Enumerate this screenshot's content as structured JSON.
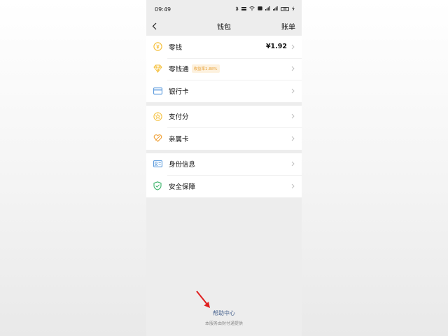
{
  "status_bar": {
    "time": "09:49",
    "battery": "88"
  },
  "nav": {
    "title": "钱包",
    "right_label": "账单"
  },
  "groups": [
    {
      "items": [
        {
          "label": "零钱",
          "value": "¥1.92",
          "icon": "yuan-coin-icon"
        },
        {
          "label": "零钱通",
          "badge": "收益率1.88%",
          "icon": "diamond-icon"
        },
        {
          "label": "银行卡",
          "icon": "bank-card-icon"
        }
      ]
    },
    {
      "items": [
        {
          "label": "支付分",
          "icon": "star-score-icon"
        },
        {
          "label": "亲属卡",
          "icon": "family-card-icon"
        }
      ]
    },
    {
      "items": [
        {
          "label": "身份信息",
          "icon": "id-card-icon"
        },
        {
          "label": "安全保障",
          "icon": "shield-check-icon"
        }
      ]
    }
  ],
  "footer": {
    "help_link": "帮助中心",
    "provider_text": "本服务由财付通提供"
  },
  "colors": {
    "accent_yellow": "#f5c242",
    "link_blue": "#4a6590",
    "arrow_red": "#e02020",
    "shield_green": "#3bb36a",
    "card_blue": "#4a90d9"
  }
}
